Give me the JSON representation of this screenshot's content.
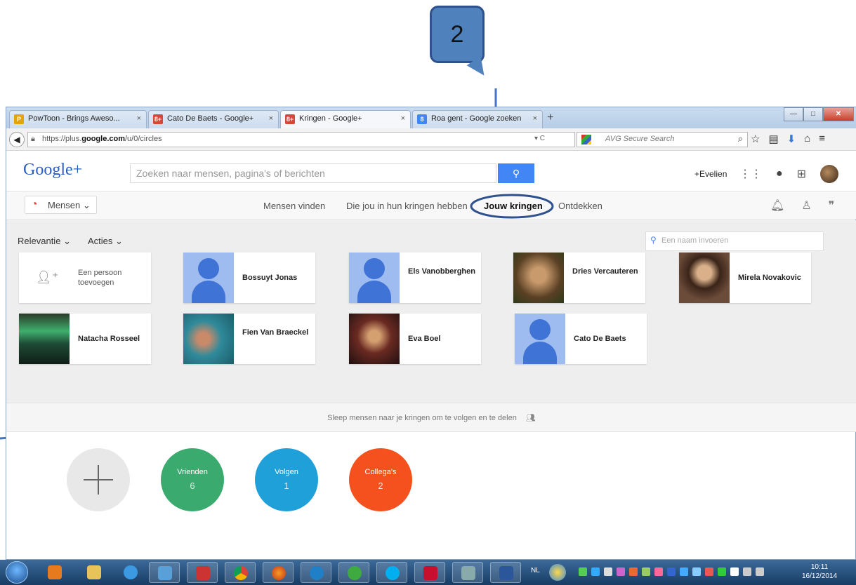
{
  "annotation": {
    "number": "2"
  },
  "tabs": [
    {
      "label": "PowToon - Brings Aweso...",
      "color": "#e5a50a",
      "glyph": "P"
    },
    {
      "label": "Cato De Baets - Google+",
      "color": "#d34836",
      "glyph": "8+"
    },
    {
      "label": "Kringen - Google+",
      "color": "#d34836",
      "glyph": "8+"
    },
    {
      "label": "Roa gent - Google zoeken",
      "color": "#4285f4",
      "glyph": "8"
    }
  ],
  "browser": {
    "url_prefix": "https://plus.",
    "url_domain": "google.com",
    "url_path": "/u/0/circles",
    "search_placeholder": "AVG Secure Search"
  },
  "gplus": {
    "logo": "Google+",
    "search_placeholder": "Zoeken naar mensen, pagina's of berichten",
    "user": "+Evelien",
    "people_menu": "Mensen",
    "nav": [
      "Mensen vinden",
      "Die jou in hun kringen hebben",
      "Jouw kringen",
      "Ontdekken"
    ],
    "sort": "Relevantie",
    "actions": "Acties",
    "filter_placeholder": "Een naam invoeren",
    "add_person": "Een persoon toevoegen",
    "drop_hint": "Sleep mensen naar je kringen om te volgen en te delen"
  },
  "people": [
    {
      "name": "Bossuyt Jonas"
    },
    {
      "name": "Els Vanobberghen"
    },
    {
      "name": "Dries Vercauteren"
    },
    {
      "name": "Mirela Novakovic"
    },
    {
      "name": "Natacha Rosseel"
    },
    {
      "name": "Fien Van Braeckel"
    },
    {
      "name": "Eva Boel"
    },
    {
      "name": "Cato De Baets"
    }
  ],
  "circles": [
    {
      "name": "Vrienden",
      "count": "6",
      "color": "#3aaa6e"
    },
    {
      "name": "Volgen",
      "count": "1",
      "color": "#20a0d8"
    },
    {
      "name": "Collega's",
      "count": "2",
      "color": "#f4511e"
    }
  ],
  "taskbar": {
    "lang": "NL",
    "time": "10:11",
    "date": "16/12/2014"
  }
}
